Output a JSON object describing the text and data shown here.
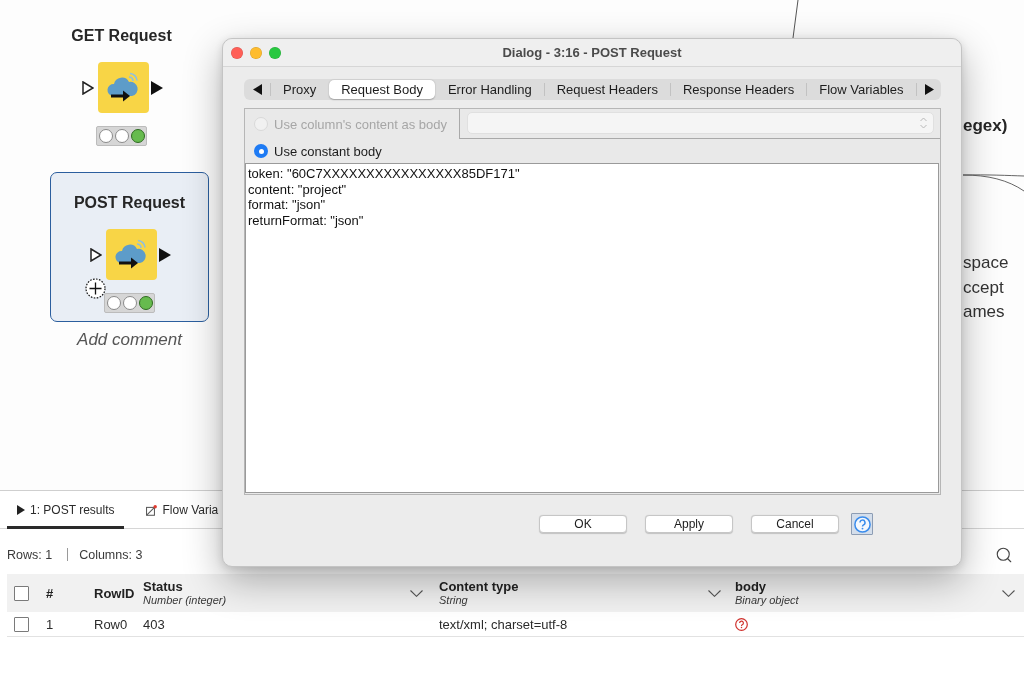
{
  "canvas": {
    "nodes": [
      {
        "title": "GET Request",
        "selected": false,
        "lights": [
          {
            "on": false
          },
          {
            "on": false
          },
          {
            "on": true
          }
        ]
      },
      {
        "title": "POST Request",
        "selected": true,
        "lights": [
          {
            "on": false
          },
          {
            "on": false
          },
          {
            "on": true
          }
        ],
        "comment_hint": "Add comment"
      }
    ],
    "hidden_node": {
      "title": "egex)"
    },
    "annotation": {
      "lines": [
        "space",
        "ccept",
        "ames"
      ]
    }
  },
  "dialog": {
    "title": "Dialog - 3:16 - POST Request",
    "tabs": [
      {
        "label": "Proxy",
        "selected": false
      },
      {
        "label": "Request Body",
        "selected": true
      },
      {
        "label": "Error Handling",
        "selected": false
      },
      {
        "label": "Request Headers",
        "selected": false
      },
      {
        "label": "Response Headers",
        "selected": false
      },
      {
        "label": "Flow Variables",
        "selected": false
      }
    ],
    "body_options": [
      {
        "label": "Use column's content as body",
        "selected": false,
        "disabled": true
      },
      {
        "label": "Use constant body",
        "selected": true,
        "disabled": false
      }
    ],
    "column_select": {
      "disabled": true
    },
    "body_text": {
      "value": "token: \"60C7XXXXXXXXXXXXXXXX85DF171\"\ncontent: \"project\"\nformat: \"json\"\nreturnFormat: \"json\""
    },
    "buttons": [
      "OK",
      "Apply",
      "Cancel"
    ]
  },
  "results": {
    "tabs": [
      {
        "label": "1: POST results",
        "kind": "table",
        "selected": true
      },
      {
        "label": "Flow Varia",
        "kind": "variables",
        "selected": false
      }
    ],
    "summary": {
      "rows": "Rows: 1",
      "columns": "Columns: 3"
    },
    "table": {
      "all_checked": false,
      "columns": [
        {
          "kind": "index",
          "name": "#"
        },
        {
          "kind": "rowid",
          "name": "RowID"
        },
        {
          "kind": "data",
          "name": "Status",
          "type": "Number (integer)"
        },
        {
          "kind": "data",
          "name": "Content type",
          "type": "String"
        },
        {
          "kind": "data",
          "name": "body",
          "type": "Binary object"
        }
      ],
      "rows": [
        {
          "checked": false,
          "cells": [
            {
              "kind": "text",
              "text": "1"
            },
            {
              "kind": "text",
              "text": "Row0"
            },
            {
              "kind": "text",
              "text": "403"
            },
            {
              "kind": "text",
              "text": "text/xml; charset=utf-8"
            },
            {
              "kind": "missing"
            }
          ]
        }
      ]
    }
  }
}
